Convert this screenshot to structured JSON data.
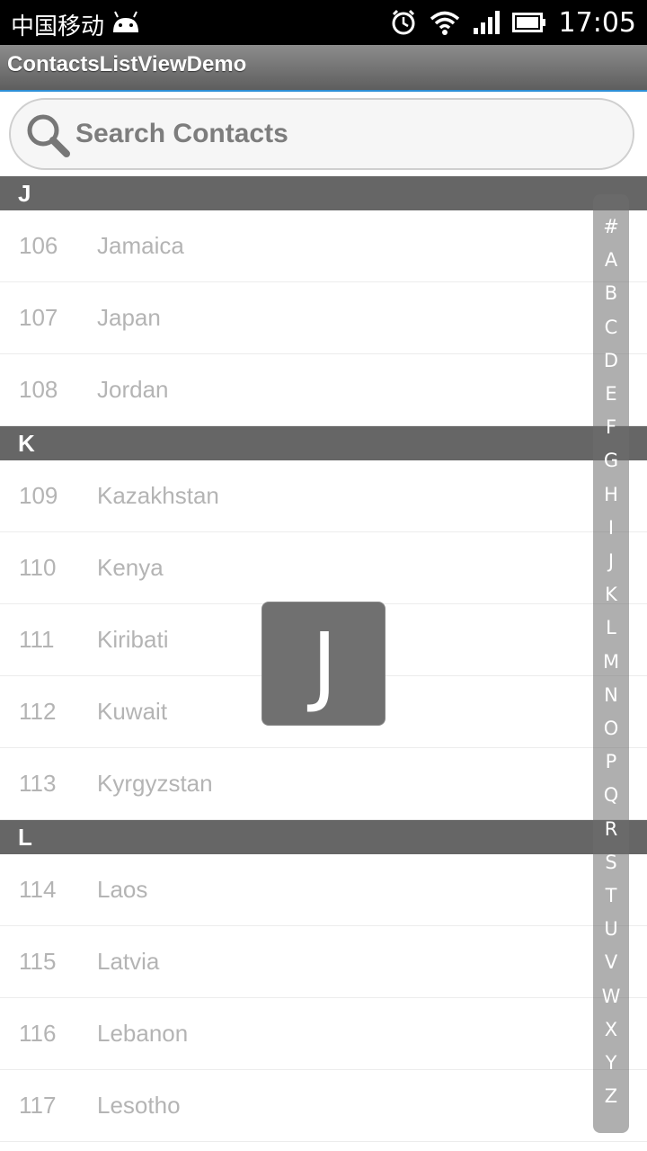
{
  "status_bar": {
    "carrier": "中国移动",
    "time": "17:05",
    "icons": [
      "android-icon",
      "alarm-icon",
      "wifi-icon",
      "signal-icon",
      "battery-icon"
    ]
  },
  "app": {
    "title": "ContactsListViewDemo"
  },
  "search": {
    "placeholder": "Search Contacts",
    "value": ""
  },
  "list": {
    "sections": [
      {
        "letter": "J",
        "items": [
          {
            "number": "106",
            "name": "Jamaica"
          },
          {
            "number": "107",
            "name": "Japan"
          },
          {
            "number": "108",
            "name": "Jordan"
          }
        ]
      },
      {
        "letter": "K",
        "items": [
          {
            "number": "109",
            "name": "Kazakhstan"
          },
          {
            "number": "110",
            "name": "Kenya"
          },
          {
            "number": "111",
            "name": "Kiribati"
          },
          {
            "number": "112",
            "name": "Kuwait"
          },
          {
            "number": "113",
            "name": "Kyrgyzstan"
          }
        ]
      },
      {
        "letter": "L",
        "items": [
          {
            "number": "114",
            "name": "Laos"
          },
          {
            "number": "115",
            "name": "Latvia"
          },
          {
            "number": "116",
            "name": "Lebanon"
          },
          {
            "number": "117",
            "name": "Lesotho"
          }
        ]
      }
    ]
  },
  "index_bar": {
    "letters": [
      "#",
      "A",
      "B",
      "C",
      "D",
      "E",
      "F",
      "G",
      "H",
      "I",
      "J",
      "K",
      "L",
      "M",
      "N",
      "O",
      "P",
      "Q",
      "R",
      "S",
      "T",
      "U",
      "V",
      "W",
      "X",
      "Y",
      "Z"
    ]
  },
  "overlay": {
    "letter": "J"
  },
  "colors": {
    "section_header_bg": "#666666",
    "action_bar_accent": "#2d8fd6",
    "item_text": "#b4b4b4"
  }
}
